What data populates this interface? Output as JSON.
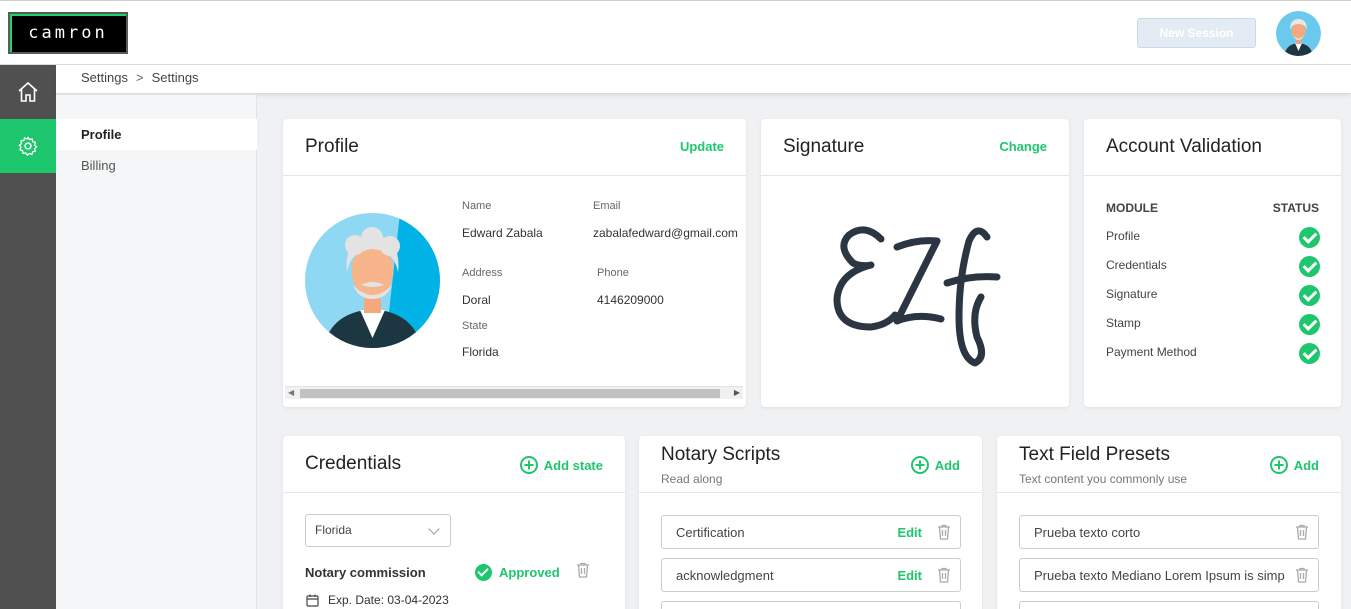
{
  "app": {
    "logo_text": "camron",
    "accent": "#1ec66d"
  },
  "header": {
    "new_session_label": "New Session"
  },
  "breadcrumb": {
    "items": [
      "Settings",
      "Settings"
    ],
    "separator": ">"
  },
  "subnav": {
    "items": [
      {
        "label": "Profile",
        "active": true
      },
      {
        "label": "Billing",
        "active": false
      }
    ]
  },
  "profile": {
    "title": "Profile",
    "action": "Update",
    "fields": {
      "name_label": "Name",
      "name": "Edward Zabala",
      "email_label": "Email",
      "email": "zabalafedward@gmail.com",
      "address_label": "Address",
      "address": "Doral",
      "phone_label": "Phone",
      "phone": "4146209000",
      "state_label": "State",
      "state": "Florida"
    }
  },
  "signature": {
    "title": "Signature",
    "action": "Change",
    "initials": "EZf"
  },
  "account_validation": {
    "title": "Account Validation",
    "col_module": "MODULE",
    "col_status": "STATUS",
    "rows": [
      "Profile",
      "Credentials",
      "Signature",
      "Stamp",
      "Payment Method"
    ]
  },
  "credentials": {
    "title": "Credentials",
    "action": "Add state",
    "state_select": "Florida",
    "commission_label": "Notary commission",
    "status": "Approved",
    "exp_date": "Exp. Date: 03-04-2023"
  },
  "notary_scripts": {
    "title": "Notary Scripts",
    "subtitle": "Read along",
    "action": "Add",
    "edit_label": "Edit",
    "items": [
      "Certification",
      "acknowledgment"
    ]
  },
  "text_presets": {
    "title": "Text Field Presets",
    "subtitle": "Text content you commonly use",
    "action": "Add",
    "items": [
      "Prueba texto corto",
      "Prueba texto Mediano Lorem Ipsum is simp"
    ]
  }
}
